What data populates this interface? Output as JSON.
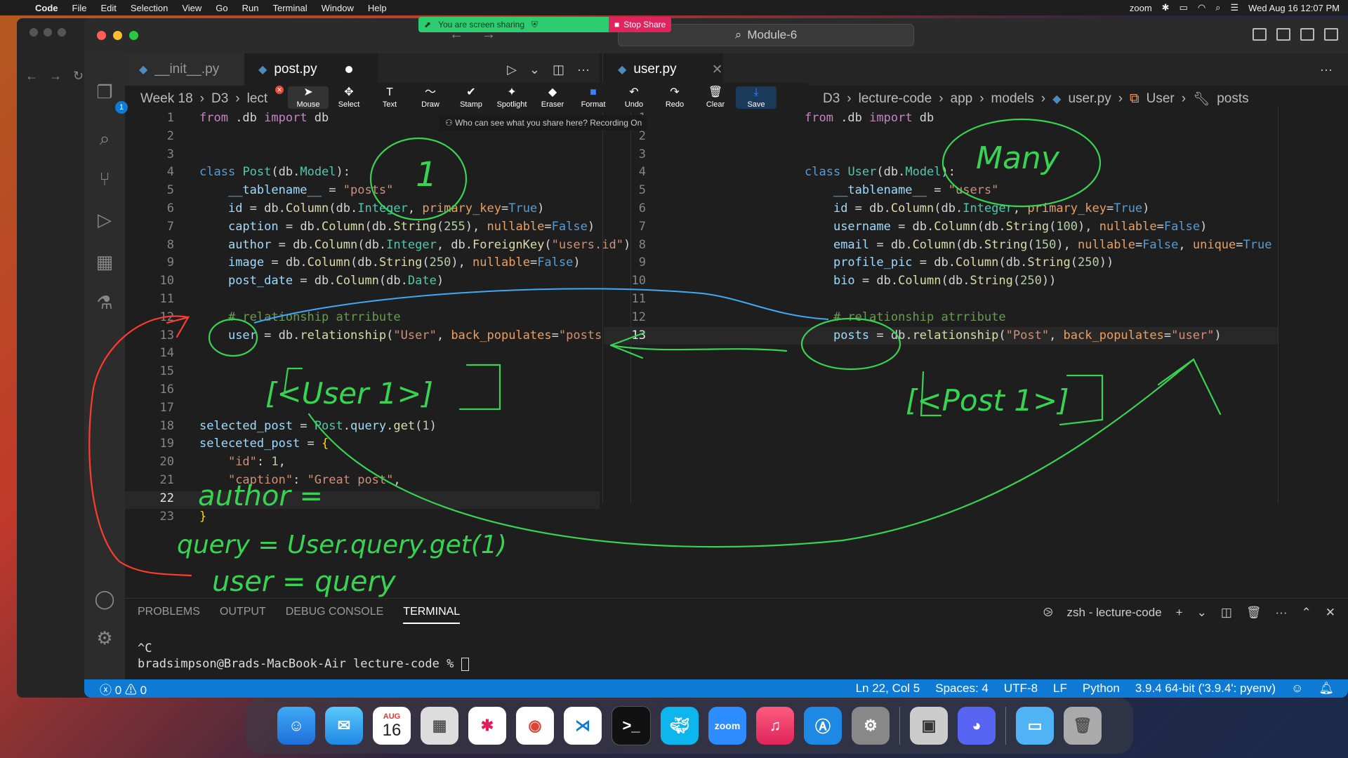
{
  "menubar": {
    "app": "Code",
    "items": [
      "File",
      "Edit",
      "Selection",
      "View",
      "Go",
      "Run",
      "Terminal",
      "Window",
      "Help"
    ],
    "datetime": "Wed Aug 16  12:07 PM",
    "zoom_label": "zoom"
  },
  "share": {
    "status": "You are screen sharing",
    "stop": "Stop Share"
  },
  "title": "Module-6",
  "left_editor": {
    "tabs": [
      {
        "label": "__init__.py",
        "active": false
      },
      {
        "label": "post.py",
        "active": true,
        "modified": true
      }
    ],
    "breadcrumb": [
      "Week 18",
      "D3",
      "lect"
    ],
    "lines": [
      "1",
      "2",
      "3",
      "4",
      "5",
      "6",
      "7",
      "8",
      "9",
      "10",
      "11",
      "12",
      "13",
      "14",
      "15",
      "16",
      "17",
      "18",
      "19",
      "20",
      "21",
      "22",
      "23"
    ]
  },
  "right_editor": {
    "tabs": [
      {
        "label": "user.py",
        "active": true
      }
    ],
    "breadcrumb": [
      "D3",
      "lecture-code",
      "app",
      "models",
      "user.py",
      "User",
      "posts"
    ],
    "lines": [
      "1",
      "2",
      "3",
      "4",
      "5",
      "6",
      "7",
      "8",
      "9",
      "10",
      "11",
      "12",
      "13"
    ]
  },
  "zoom_toolbar": {
    "tools": [
      "Mouse",
      "Select",
      "Text",
      "Draw",
      "Stamp",
      "Spotlight",
      "Eraser",
      "Format",
      "Undo",
      "Redo",
      "Clear",
      "Save"
    ],
    "info": "Who can see what you share here? Recording On"
  },
  "panel": {
    "tabs": [
      "PROBLEMS",
      "OUTPUT",
      "DEBUG CONSOLE",
      "TERMINAL"
    ],
    "terminal_name": "zsh - lecture-code",
    "line1": "^C",
    "line2": "bradsimpson@Brads-MacBook-Air lecture-code % "
  },
  "status": {
    "errors": "0",
    "warnings": "0",
    "position": "Ln 22, Col 5",
    "spaces": "Spaces: 4",
    "encoding": "UTF-8",
    "eol": "LF",
    "language": "Python",
    "interpreter": "3.9.4 64-bit ('3.9.4': pyenv)"
  },
  "dock": {
    "calendar_month": "AUG",
    "calendar_day": "16",
    "zoom_label": "zoom"
  },
  "annotations": {
    "one": "1",
    "many": "Many",
    "user1": "[<User 1>]",
    "post1": "[<Post 1>]",
    "author": "author = ",
    "query": "query = User.query.get(1)",
    "userq": "user = query"
  },
  "colors": {
    "accent": "#0e7ad3",
    "share_green": "#2ecc71",
    "stop_red": "#e0245e",
    "ink_green": "#39d353",
    "ink_red": "#ff3b30",
    "ink_blue": "#3fa9f5"
  }
}
